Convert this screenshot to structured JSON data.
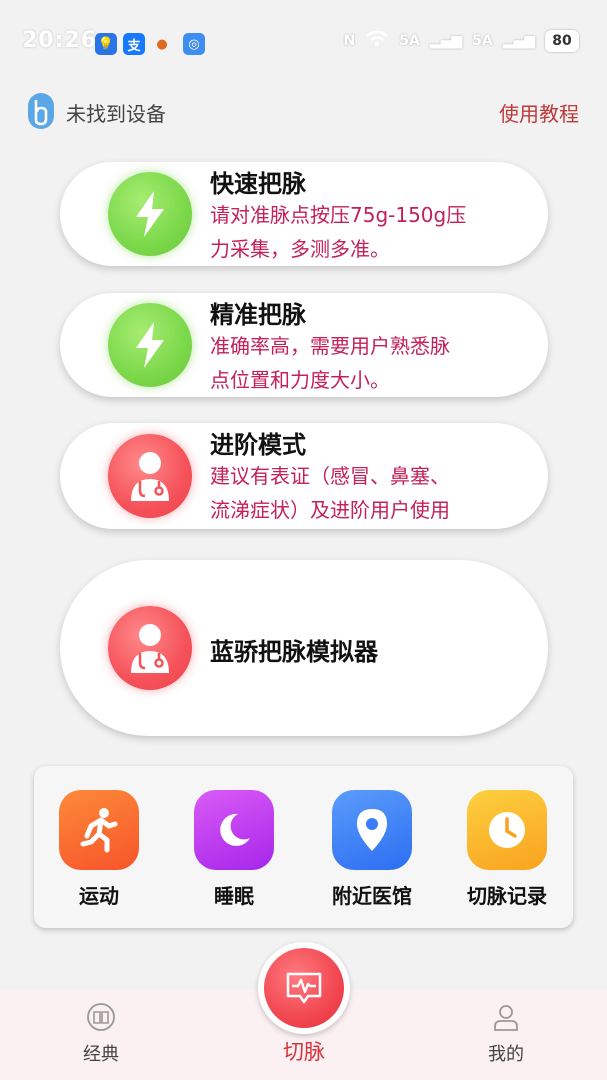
{
  "status_bar": {
    "time": "20:26",
    "battery": "80",
    "network_1": "5A",
    "network_2": "5A"
  },
  "header": {
    "device_status": "未找到设备",
    "tutorial_link": "使用教程"
  },
  "modes": [
    {
      "title": "快速把脉",
      "desc_line1": "请对准脉点按压75g-150g压",
      "desc_line2": "力采集，多测多准。",
      "icon": "lightning-icon"
    },
    {
      "title": "精准把脉",
      "desc_line1": "准确率高，需要用户熟悉脉",
      "desc_line2": "点位置和力度大小。",
      "icon": "lightning-icon"
    },
    {
      "title": "进阶模式",
      "desc_line1": "建议有表证（感冒、鼻塞、",
      "desc_line2": "流涕症状）及进阶用户使用",
      "icon": "doctor-icon"
    },
    {
      "title": "蓝骄把脉模拟器",
      "icon": "doctor-icon"
    }
  ],
  "shortcuts": [
    {
      "label": "运动",
      "icon": "running-icon",
      "color": "#fb6a2e"
    },
    {
      "label": "睡眠",
      "icon": "moon-icon",
      "color": "#c13bf0"
    },
    {
      "label": "附近医馆",
      "icon": "location-pin-icon",
      "color": "#3b7df6"
    },
    {
      "label": "切脉记录",
      "icon": "clock-icon",
      "color": "#fbb62c"
    }
  ],
  "bottom_nav": {
    "classics": "经典",
    "pulse": "切脉",
    "mine": "我的"
  },
  "colors": {
    "accent_red": "#d8333d",
    "desc_text": "#c4205a",
    "green": "#7bd84a"
  }
}
